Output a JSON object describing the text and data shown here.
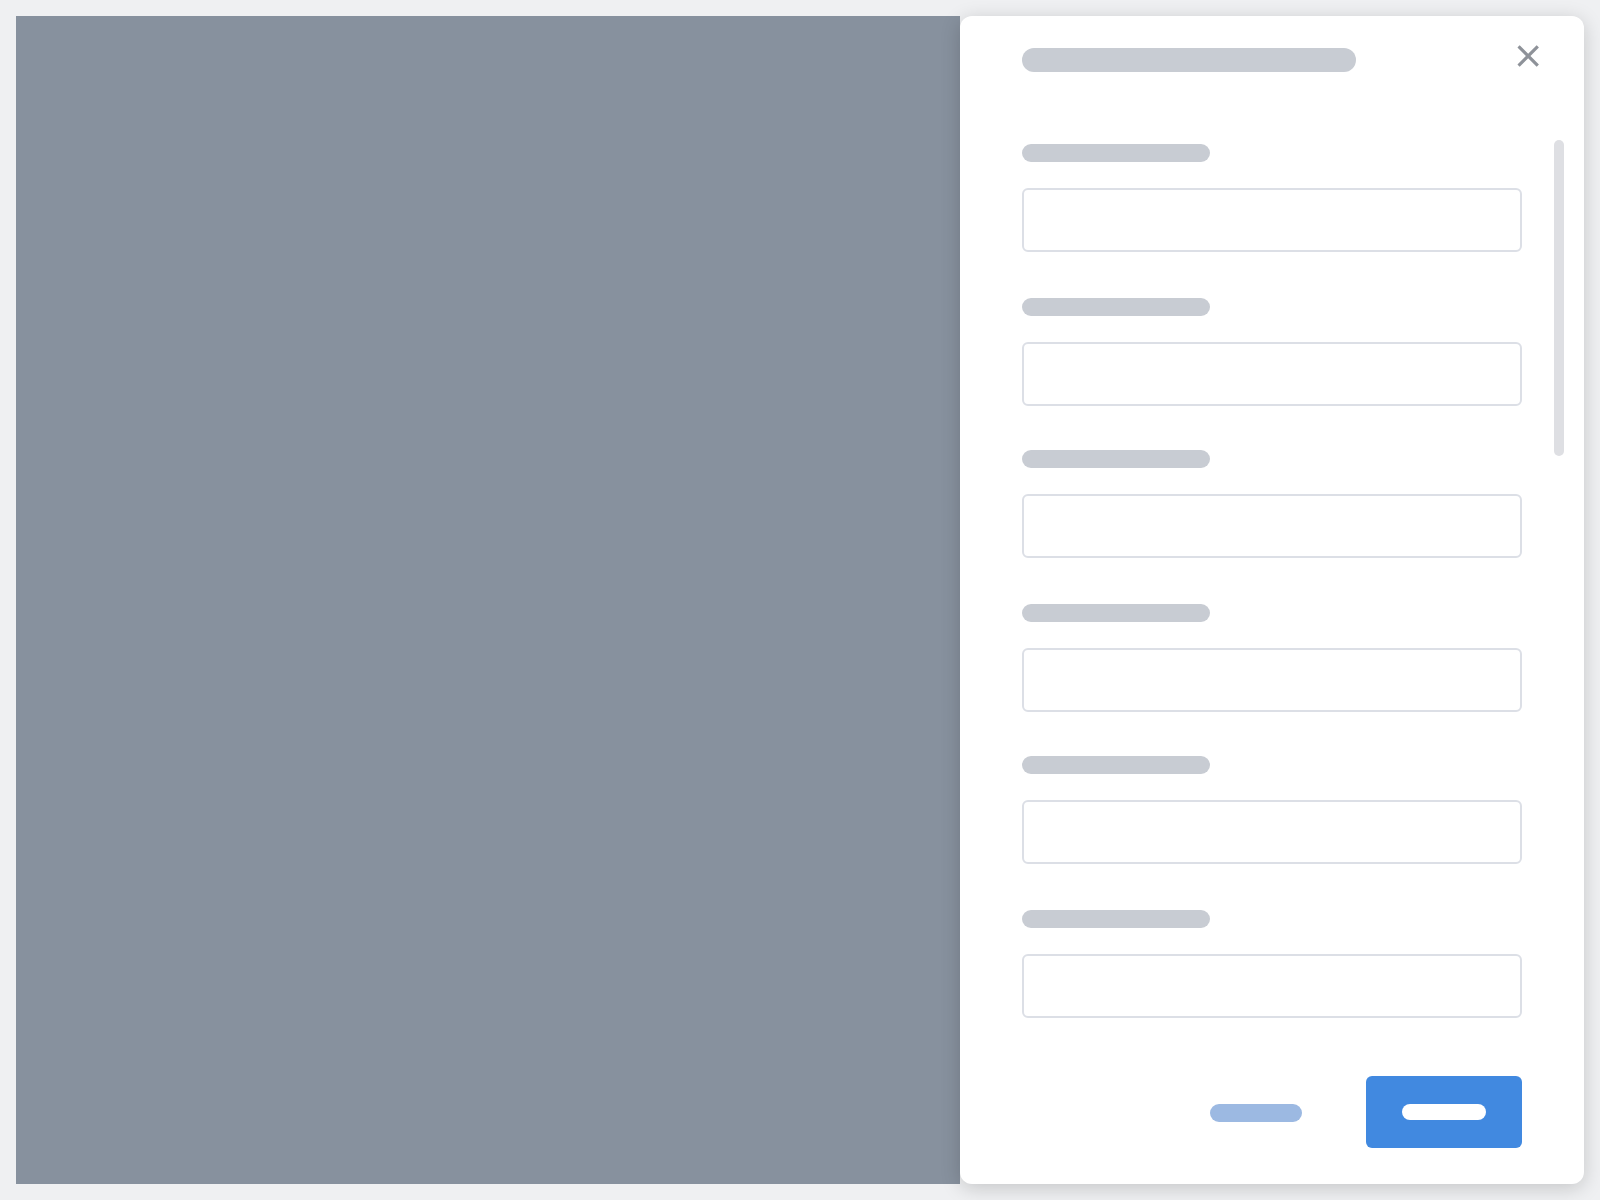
{
  "drawer": {
    "loading": true,
    "close": "×",
    "fields": [
      {
        "kind": "input"
      },
      {
        "kind": "input"
      },
      {
        "kind": "input"
      },
      {
        "kind": "input"
      },
      {
        "kind": "input"
      },
      {
        "kind": "input"
      }
    ],
    "footer": {
      "buttons": [
        {
          "kind": "text"
        },
        {
          "kind": "primary"
        }
      ]
    }
  }
}
